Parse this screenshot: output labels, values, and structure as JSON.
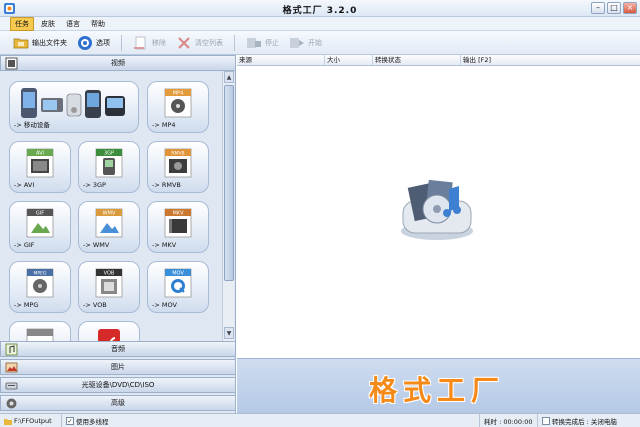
{
  "window": {
    "title": "格式工厂 3.2.0",
    "minimize": "–",
    "maximize": "□",
    "close": "×"
  },
  "menu": [
    {
      "label": "任务"
    },
    {
      "label": "皮肤"
    },
    {
      "label": "语言"
    },
    {
      "label": "帮助"
    }
  ],
  "toolbar": {
    "output_folder": "输出文件夹",
    "options": "选项",
    "remove": "移除",
    "clear_list": "清空列表",
    "stop": "停止",
    "start": "开始"
  },
  "left": {
    "video_header": "视频",
    "audio_header": "音频",
    "image_header": "图片",
    "rom_header": "光驱设备\\DVD\\CD\\ISO",
    "advanced_header": "高级",
    "formats": [
      {
        "label": "-> 移动设备",
        "badge": ""
      },
      {
        "label": "-> MP4",
        "badge": "MP4"
      },
      {
        "label": "-> AVI",
        "badge": "AVI"
      },
      {
        "label": "-> 3GP",
        "badge": "3GP"
      },
      {
        "label": "-> RMVB",
        "badge": "RMVB"
      },
      {
        "label": "-> GIF",
        "badge": "GIF"
      },
      {
        "label": "-> WMV",
        "badge": "WMV"
      },
      {
        "label": "-> MKV",
        "badge": "MKV"
      },
      {
        "label": "-> MPG",
        "badge": "MPEG"
      },
      {
        "label": "-> VOB",
        "badge": "VOB"
      },
      {
        "label": "-> MOV",
        "badge": "MOV"
      }
    ]
  },
  "list": {
    "columns": [
      "来源",
      "大小",
      "转换状态",
      "输出 [F2]"
    ]
  },
  "banner": {
    "text": "格式工厂"
  },
  "status": {
    "output_path": "F:\\FFOutput",
    "multithread_check": "✓",
    "multithread": "使用多线程",
    "elapsed": "耗时 : 00:00:00",
    "after_done": "转换完成后 : 关闭电脑"
  },
  "colors": {
    "accent": "#f58a18",
    "menu_active": "#f6c94f",
    "panel": "#dfe7f2"
  }
}
